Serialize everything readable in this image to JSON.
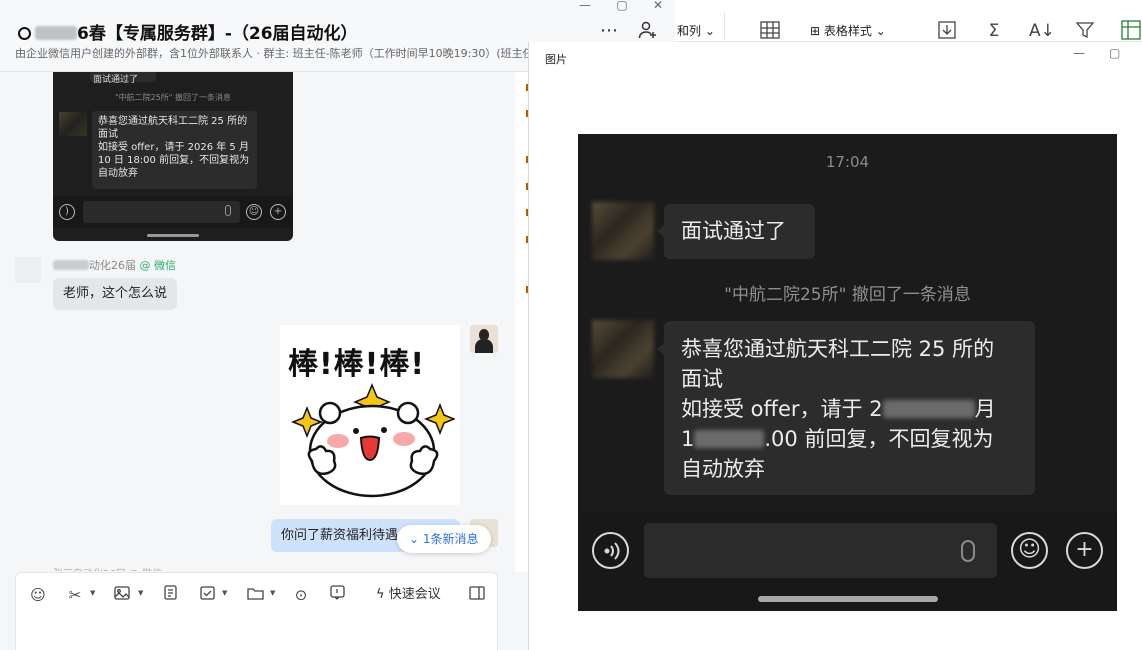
{
  "chat": {
    "title_suffix": "6春【专属服务群】-（26届自动化）",
    "subtitle": "由企业微信用户创建的外部群，含1位外部联系人 · 群主: 班主任-陈老师（工作时间早10晚19:30）(班主任-陈",
    "embedded_screenshot": {
      "top_bubble": "面试通过了",
      "recall_notice": "\"中航二院25所\" 撤回了一条消息",
      "message_lines": [
        "恭喜您通过航天科工二院 25 所的",
        "面试",
        "如接受 offer，请于 2026 年 5 月",
        "10 日 18:00 前回复，不回复视为",
        "自动放弃"
      ]
    },
    "incoming": {
      "sender_suffix": "动化26届",
      "sender_source": "@ 微信",
      "text": "老师，这个怎么说"
    },
    "sticker_text": "棒!棒!棒!",
    "outgoing_text": "你问了薪资福利待遇",
    "new_message_badge": "1条新消息",
    "next_sender_partial": "张三自动化26届 @ 微信",
    "toolbar": {
      "quick_meeting": "快速会议"
    }
  },
  "sheet": {
    "column_menu": "和列",
    "table_style": "表格样式"
  },
  "viewer": {
    "title": "图片",
    "photo": {
      "time": "17:04",
      "bubble1": "面试通过了",
      "recall_notice": "\"中航二院25所\" 撤回了一条消息",
      "line1": "恭喜您通过航天科工二院 25 所的",
      "line2": "面试",
      "line3_prefix": "如接受 offer，请于 2",
      "line3_suffix": "月",
      "line4_prefix": "1",
      "line4_suffix": ".00 前回复，不回复视为",
      "line5": "自动放弃"
    }
  },
  "colors": {
    "chat_bg": "#f5f6f7",
    "outgoing_bubble": "#cfe2fb",
    "accent_blue": "#2f6fe0",
    "wechat_green": "#2bae67",
    "photo_bg": "#1b1b1b"
  }
}
